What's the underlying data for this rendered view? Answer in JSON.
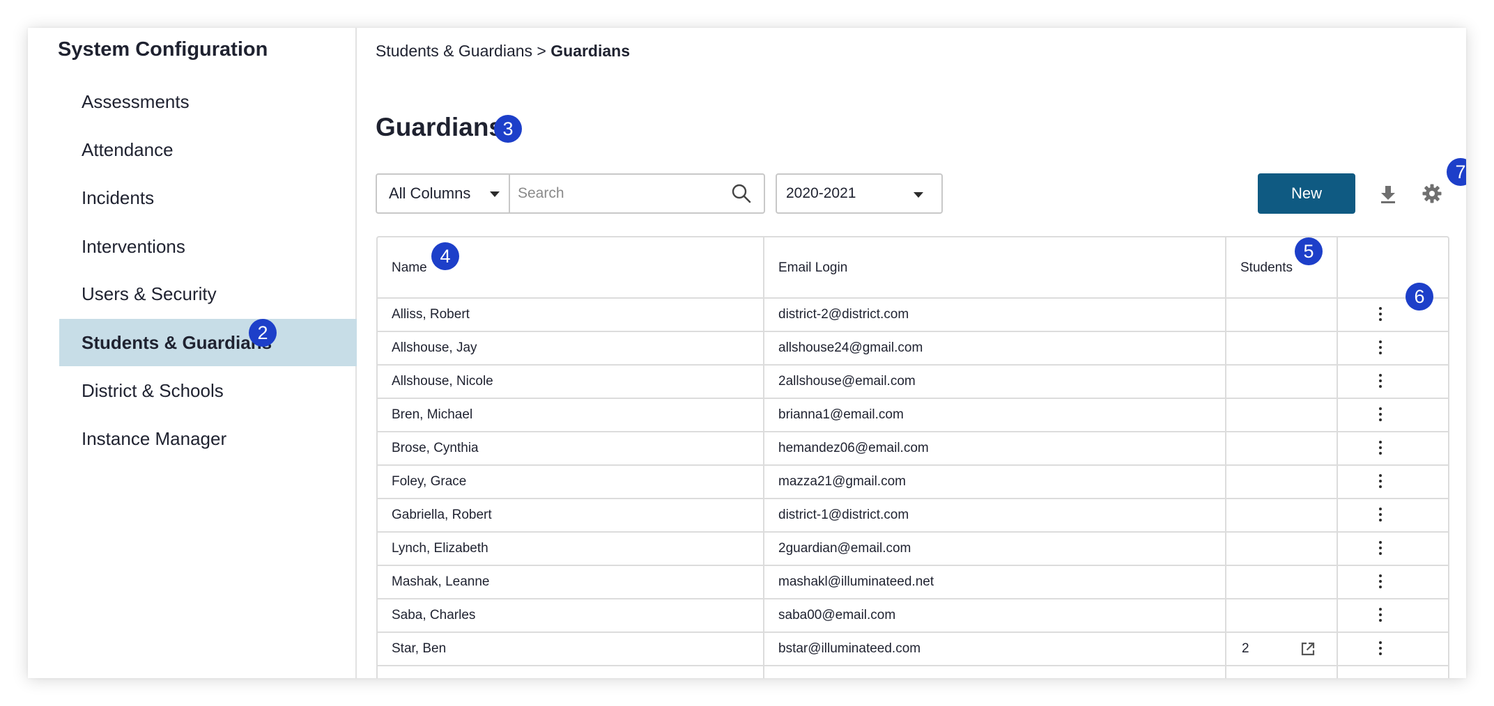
{
  "sidebar": {
    "title": "System Configuration",
    "items": [
      {
        "label": "Assessments"
      },
      {
        "label": "Attendance"
      },
      {
        "label": "Incidents"
      },
      {
        "label": "Interventions"
      },
      {
        "label": "Users & Security"
      },
      {
        "label": "Students & Guardians",
        "active": true,
        "badge": "2"
      },
      {
        "label": "District & Schools"
      },
      {
        "label": "Instance Manager"
      }
    ]
  },
  "breadcrumb": {
    "parent": "Students & Guardians",
    "separator": ">",
    "current": "Guardians"
  },
  "page": {
    "title": "Guardians",
    "title_badge": "3"
  },
  "toolbar": {
    "column_filter": "All Columns",
    "search_placeholder": "Search",
    "search_value": "",
    "year": "2020-2021",
    "new_label": "New",
    "settings_badge": "7",
    "download_icon": "download-icon",
    "settings_icon": "gear-icon",
    "search_icon": "search-icon"
  },
  "table": {
    "columns": [
      {
        "label": "Name",
        "badge": "4"
      },
      {
        "label": "Email Login"
      },
      {
        "label": "Students",
        "badge": "5"
      },
      {
        "label": "",
        "badge": "6"
      }
    ],
    "rows": [
      {
        "name": "Alliss, Robert",
        "email": "district-2@district.com",
        "students": ""
      },
      {
        "name": "Allshouse, Jay",
        "email": "allshouse24@gmail.com",
        "students": ""
      },
      {
        "name": "Allshouse, Nicole",
        "email": "2allshouse@email.com",
        "students": ""
      },
      {
        "name": "Bren, Michael",
        "email": "brianna1@email.com",
        "students": ""
      },
      {
        "name": "Brose, Cynthia",
        "email": "hemandez06@email.com",
        "students": ""
      },
      {
        "name": "Foley, Grace",
        "email": "mazza21@gmail.com",
        "students": ""
      },
      {
        "name": "Gabriella, Robert",
        "email": "district-1@district.com",
        "students": ""
      },
      {
        "name": "Lynch, Elizabeth",
        "email": "2guardian@email.com",
        "students": ""
      },
      {
        "name": "Mashak, Leanne",
        "email": "mashakl@illuminateed.net",
        "students": ""
      },
      {
        "name": "Saba, Charles",
        "email": "saba00@email.com",
        "students": ""
      },
      {
        "name": "Star, Ben",
        "email": "bstar@illuminateed.com",
        "students": "2"
      }
    ]
  },
  "colors": {
    "accent": "#0f5a82",
    "badge": "#1d3fc9",
    "active_nav": "#c7dde7"
  }
}
